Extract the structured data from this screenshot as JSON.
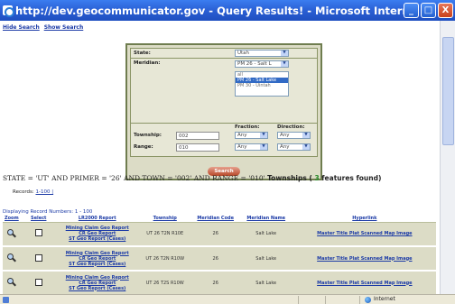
{
  "window": {
    "title": "http://dev.geocommunicator.gov - Query Results! - Microsoft Internet Explorer",
    "minimize": "_",
    "maximize": "□",
    "close": "X"
  },
  "toplinks": {
    "hide_search": "Hide Search",
    "show_search": "Show Search"
  },
  "form": {
    "state_label": "State:",
    "state_value": "Utah",
    "meridian_label": "Meridian:",
    "meridian_selected": "PM 26 - Salt L",
    "meridian_options": [
      "all",
      "PM 26 - Salt Lake",
      "PM 30 - Uintah"
    ],
    "meridian_selected_index": 1,
    "fraction_label": "Fraction:",
    "direction_label": "Direction:",
    "township_label": "Township:",
    "township_value": "002",
    "township_fraction": "Any",
    "township_direction": "Any",
    "range_label": "Range:",
    "range_value": "010",
    "range_fraction": "Any",
    "range_direction": "Any",
    "search_button": "Search"
  },
  "query_text": {
    "prefix": "STATE = 'UT' AND PRIMER = '26' AND TOWN = '002' AND RANGE = '010'",
    "type_label": "Townships",
    "open": " ( ",
    "count": "3",
    "suffix": " features found)"
  },
  "records": {
    "label": "Records:",
    "link": "1-100 |"
  },
  "displaying": "Displaying Record Numbers: 1 - 100",
  "table": {
    "headers": [
      "Zoom",
      "Select",
      "LR2000 Report",
      "Township",
      "Meridian Code",
      "Meridian Name",
      "Hyperlink"
    ],
    "rows": [
      {
        "reports": [
          "Mining Claim Geo Report",
          "CR Geo Report",
          "ST Geo Report (Cases)"
        ],
        "township": "UT 26   T2N R10E",
        "meridian_code": "26",
        "meridian_name": "Salt Lake",
        "hyperlink": "Master Title Plat Scanned Map Image"
      },
      {
        "reports": [
          "Mining Claim Geo Report",
          "CR Geo Report",
          "ST Geo Report (Cases)"
        ],
        "township": "UT 26   T2N R10W",
        "meridian_code": "26",
        "meridian_name": "Salt Lake",
        "hyperlink": "Master Title Plat Scanned Map Image"
      },
      {
        "reports": [
          "Mining Claim Geo Report",
          "CR Geo Report",
          "ST Geo Report (Cases)"
        ],
        "township": "UT 26   T2S R10W",
        "meridian_code": "26",
        "meridian_name": "Salt Lake",
        "hyperlink": "Master Title Plat Scanned Map Image"
      }
    ]
  },
  "status": {
    "zone": "Internet"
  }
}
